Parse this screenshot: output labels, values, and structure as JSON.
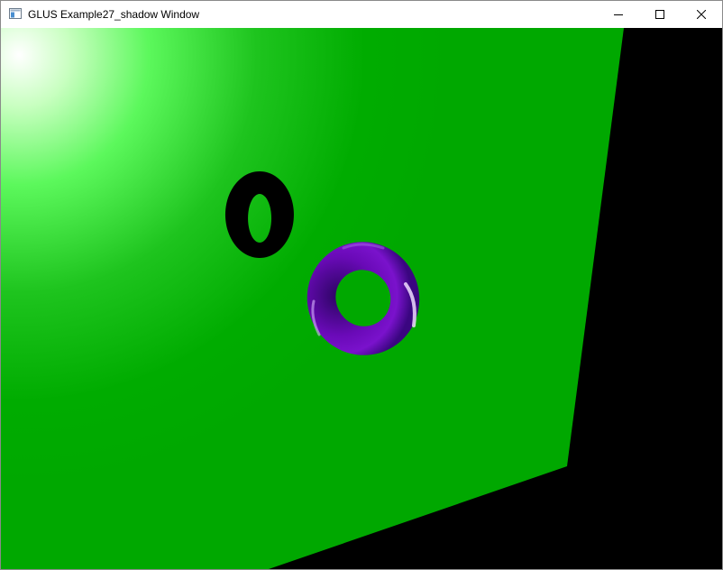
{
  "window": {
    "title": "GLUS Example27_shadow Window",
    "controls": {
      "minimize_icon": "minimize-icon",
      "maximize_icon": "maximize-icon",
      "close_icon": "close-icon"
    }
  },
  "scene": {
    "background_color": "#000000",
    "plane_color": "#00a800",
    "plane_highlight_color": "#ffffff",
    "shadow_color": "#000000",
    "torus_color": "#6a0ab8"
  }
}
